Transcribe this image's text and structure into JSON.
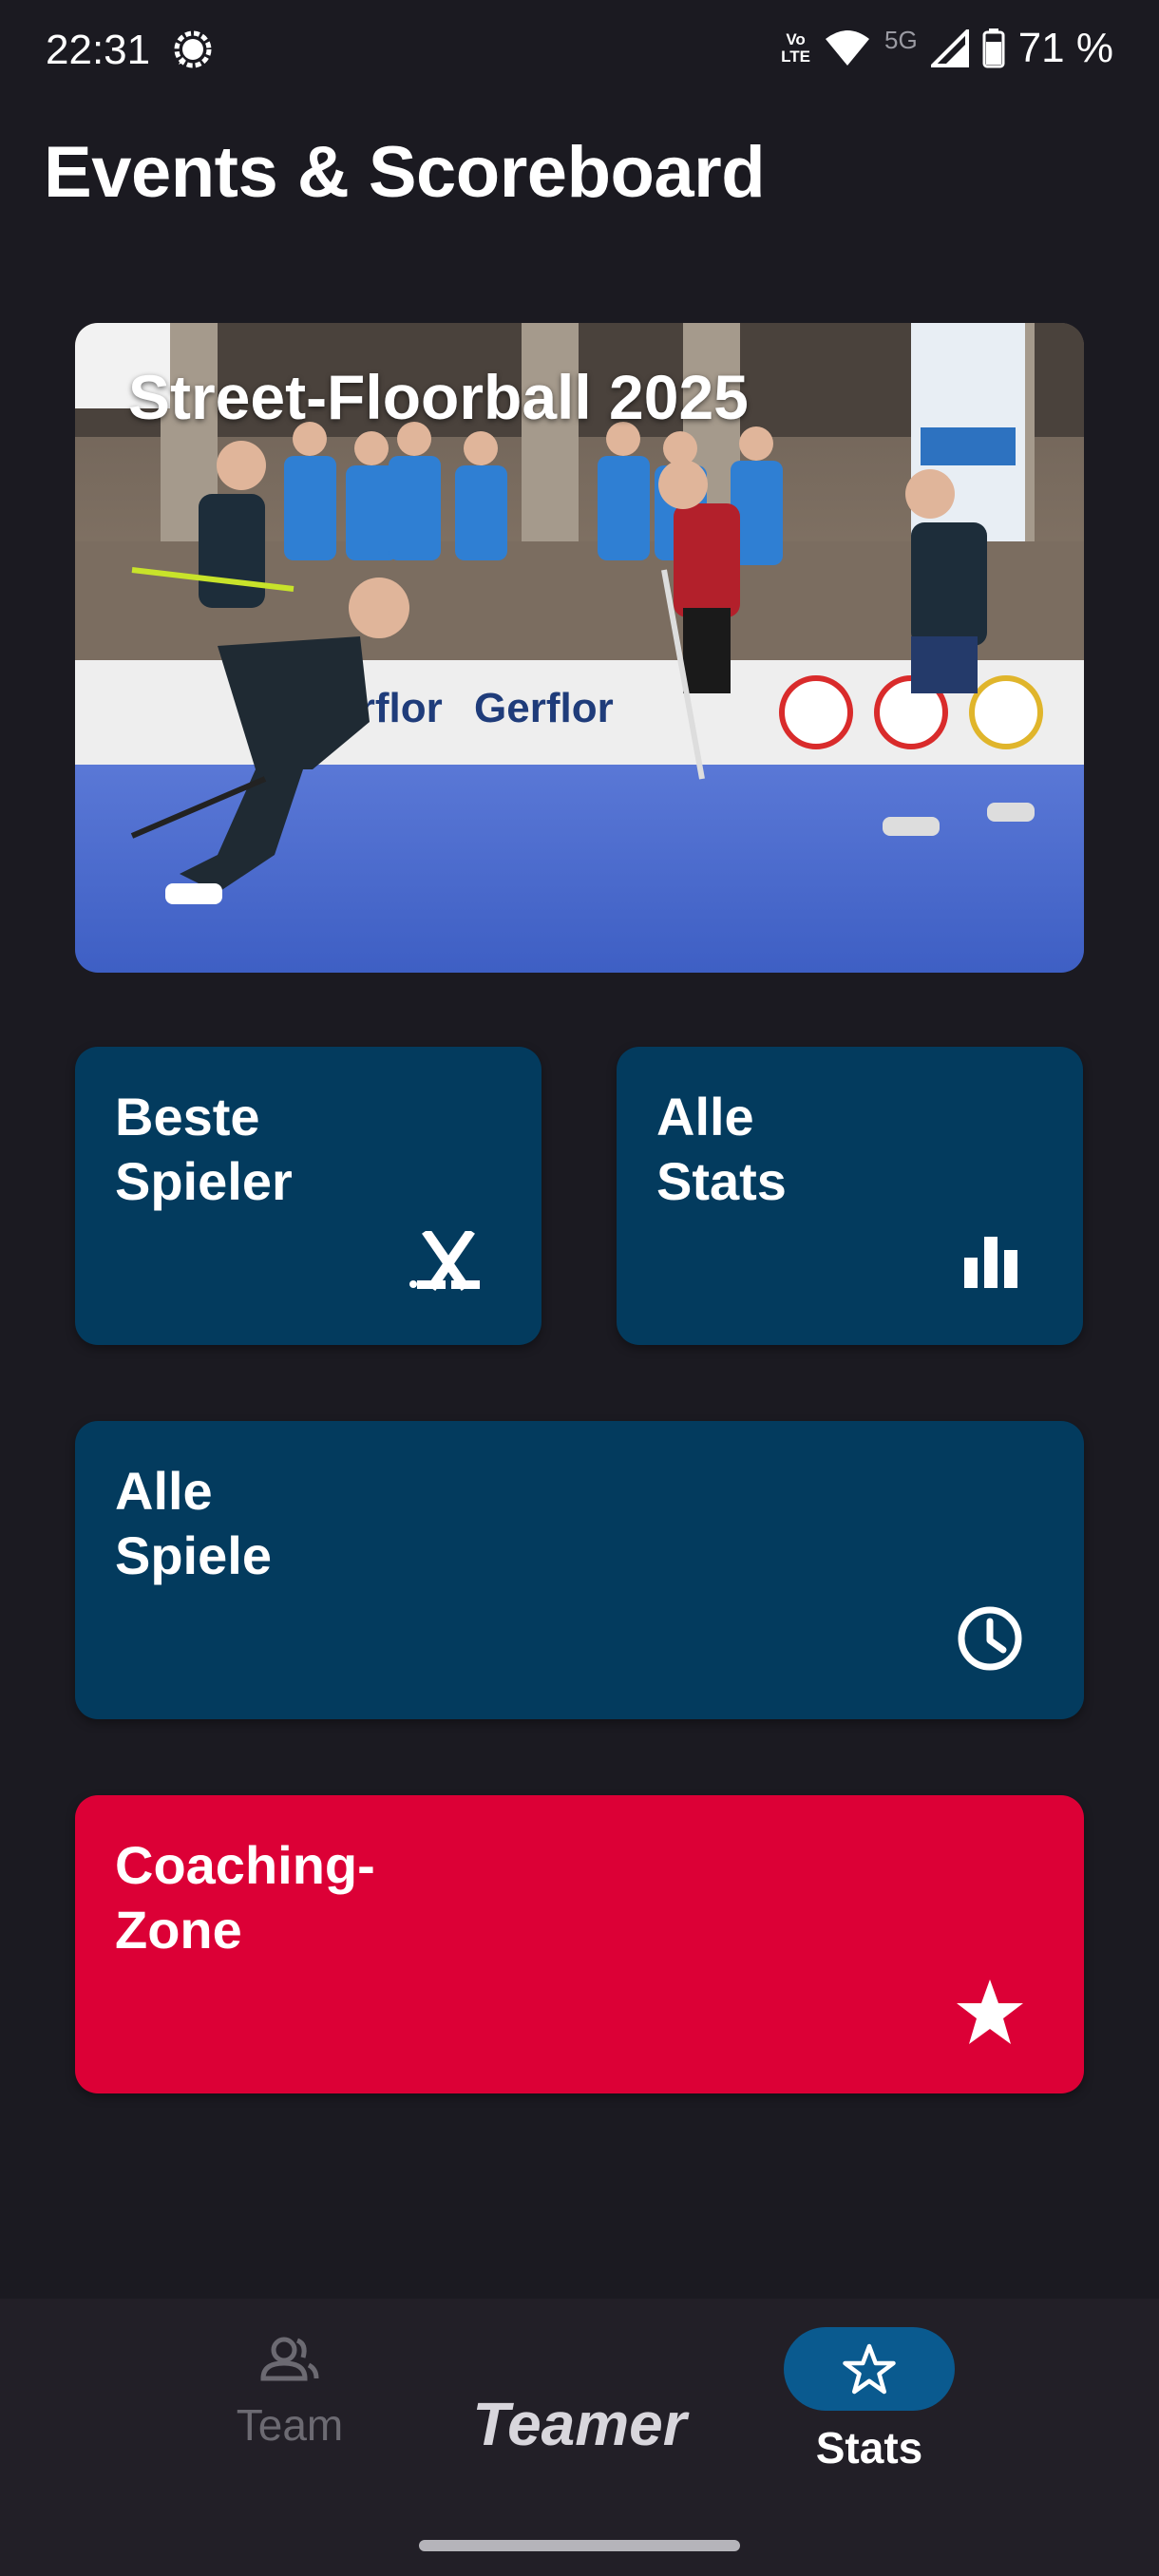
{
  "status_bar": {
    "time": "22:31",
    "volte_line1": "Vo",
    "volte_line2": "LTE",
    "network": "5G",
    "battery": "71 %",
    "icons": [
      "chat-bubble-icon",
      "wifi-icon",
      "signal-icon",
      "battery-icon"
    ]
  },
  "header": {
    "title": "Events & Scoreboard"
  },
  "hero": {
    "title": "Street-Floorball 2025"
  },
  "tiles": {
    "best_players": {
      "line1": "Beste",
      "line2": "Spieler",
      "icon": "floorball-sticks-icon"
    },
    "all_stats": {
      "line1": "Alle",
      "line2": "Stats",
      "icon": "bar-chart-icon"
    },
    "all_games": {
      "line1": "Alle",
      "line2": "Spiele",
      "icon": "clock-icon"
    },
    "coaching": {
      "line1": "Coaching-",
      "line2": "Zone",
      "icon": "star-icon"
    }
  },
  "colors": {
    "background": "#1b1a21",
    "tile_blue": "#033b5e",
    "tile_red": "#dc0036",
    "nav_active": "#0a5a8f"
  },
  "bottom_nav": {
    "team_label": "Team",
    "brand": "Teamer",
    "stats_label": "Stats"
  }
}
